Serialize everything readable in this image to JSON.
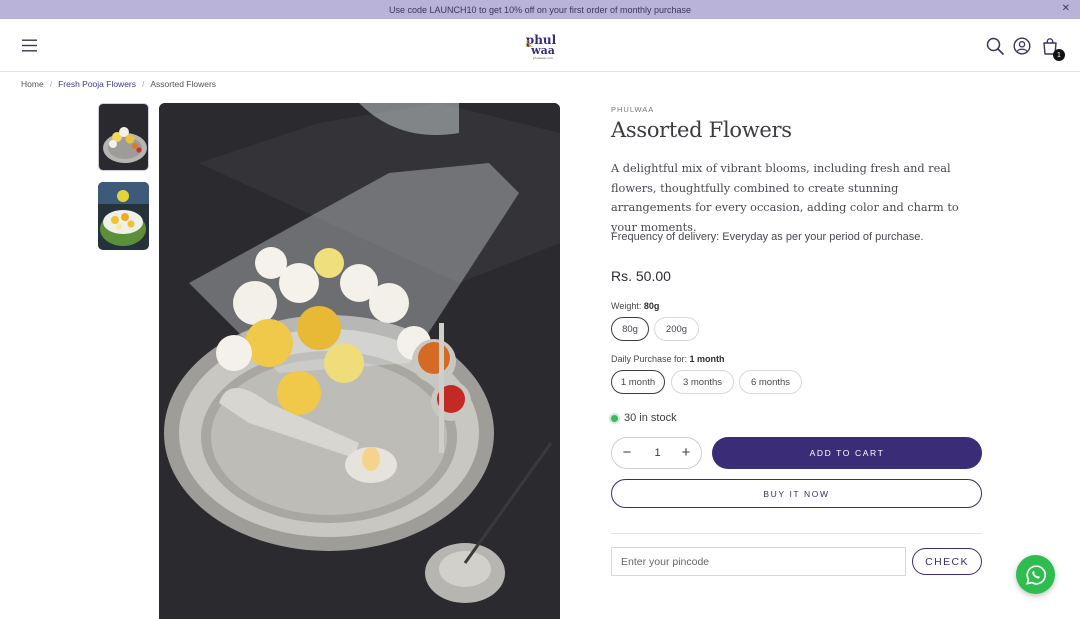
{
  "announcement": {
    "text": "Use code LAUNCH10 to get 10% off on your first order of monthly purchase",
    "close_icon": "close-icon"
  },
  "header": {
    "logo_text_top": "phul",
    "logo_text_bottom": "waa",
    "logo_tagline": "phulwaa.com",
    "icons": [
      "menu-icon",
      "search-icon",
      "account-icon",
      "cart-icon"
    ],
    "cart_count": "1"
  },
  "breadcrumb": {
    "home": "Home",
    "category": "Fresh Pooja Flowers",
    "current": "Assorted Flowers",
    "separator": "/"
  },
  "product": {
    "vendor": "PHULWAA",
    "title": "Assorted Flowers",
    "description": "A delightful mix of vibrant blooms, including fresh and real flowers, thoughtfully combined to create stunning arrangements for every occasion, adding color and charm to your moments.",
    "frequency": "Frequency of delivery: Everyday as per your period of purchase.",
    "price": "Rs. 50.00",
    "weight": {
      "label": "Weight:",
      "selected": "80g",
      "options": [
        "80g",
        "200g"
      ]
    },
    "daily_purchase": {
      "label": "Daily Purchase for:",
      "selected": "1 month",
      "options": [
        "1 month",
        "3 months",
        "6 months"
      ]
    },
    "stock": "30 in stock",
    "quantity": "1",
    "add_to_cart": "ADD TO CART",
    "buy_now": "BUY IT NOW",
    "pincode_placeholder": "Enter your pincode",
    "check_label": "CHECK"
  },
  "colors": {
    "accent": "#3b2c78",
    "announcement_bg": "#b9b3d8",
    "in_stock": "#3aba5c",
    "whatsapp": "#2fbd4f"
  },
  "floating": {
    "whatsapp_icon": "whatsapp-icon"
  }
}
